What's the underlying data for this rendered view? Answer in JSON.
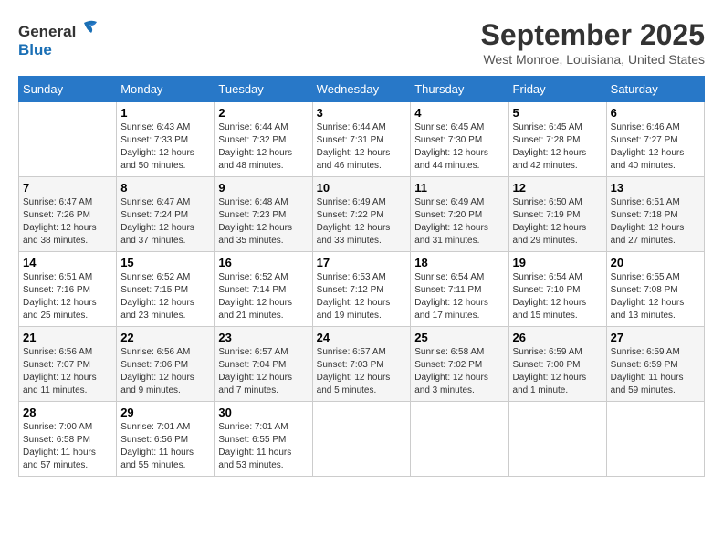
{
  "logo": {
    "line1": "General",
    "line2": "Blue"
  },
  "title": "September 2025",
  "location": "West Monroe, Louisiana, United States",
  "days_of_week": [
    "Sunday",
    "Monday",
    "Tuesday",
    "Wednesday",
    "Thursday",
    "Friday",
    "Saturday"
  ],
  "weeks": [
    [
      {
        "num": "",
        "info": ""
      },
      {
        "num": "1",
        "info": "Sunrise: 6:43 AM\nSunset: 7:33 PM\nDaylight: 12 hours\nand 50 minutes."
      },
      {
        "num": "2",
        "info": "Sunrise: 6:44 AM\nSunset: 7:32 PM\nDaylight: 12 hours\nand 48 minutes."
      },
      {
        "num": "3",
        "info": "Sunrise: 6:44 AM\nSunset: 7:31 PM\nDaylight: 12 hours\nand 46 minutes."
      },
      {
        "num": "4",
        "info": "Sunrise: 6:45 AM\nSunset: 7:30 PM\nDaylight: 12 hours\nand 44 minutes."
      },
      {
        "num": "5",
        "info": "Sunrise: 6:45 AM\nSunset: 7:28 PM\nDaylight: 12 hours\nand 42 minutes."
      },
      {
        "num": "6",
        "info": "Sunrise: 6:46 AM\nSunset: 7:27 PM\nDaylight: 12 hours\nand 40 minutes."
      }
    ],
    [
      {
        "num": "7",
        "info": "Sunrise: 6:47 AM\nSunset: 7:26 PM\nDaylight: 12 hours\nand 38 minutes."
      },
      {
        "num": "8",
        "info": "Sunrise: 6:47 AM\nSunset: 7:24 PM\nDaylight: 12 hours\nand 37 minutes."
      },
      {
        "num": "9",
        "info": "Sunrise: 6:48 AM\nSunset: 7:23 PM\nDaylight: 12 hours\nand 35 minutes."
      },
      {
        "num": "10",
        "info": "Sunrise: 6:49 AM\nSunset: 7:22 PM\nDaylight: 12 hours\nand 33 minutes."
      },
      {
        "num": "11",
        "info": "Sunrise: 6:49 AM\nSunset: 7:20 PM\nDaylight: 12 hours\nand 31 minutes."
      },
      {
        "num": "12",
        "info": "Sunrise: 6:50 AM\nSunset: 7:19 PM\nDaylight: 12 hours\nand 29 minutes."
      },
      {
        "num": "13",
        "info": "Sunrise: 6:51 AM\nSunset: 7:18 PM\nDaylight: 12 hours\nand 27 minutes."
      }
    ],
    [
      {
        "num": "14",
        "info": "Sunrise: 6:51 AM\nSunset: 7:16 PM\nDaylight: 12 hours\nand 25 minutes."
      },
      {
        "num": "15",
        "info": "Sunrise: 6:52 AM\nSunset: 7:15 PM\nDaylight: 12 hours\nand 23 minutes."
      },
      {
        "num": "16",
        "info": "Sunrise: 6:52 AM\nSunset: 7:14 PM\nDaylight: 12 hours\nand 21 minutes."
      },
      {
        "num": "17",
        "info": "Sunrise: 6:53 AM\nSunset: 7:12 PM\nDaylight: 12 hours\nand 19 minutes."
      },
      {
        "num": "18",
        "info": "Sunrise: 6:54 AM\nSunset: 7:11 PM\nDaylight: 12 hours\nand 17 minutes."
      },
      {
        "num": "19",
        "info": "Sunrise: 6:54 AM\nSunset: 7:10 PM\nDaylight: 12 hours\nand 15 minutes."
      },
      {
        "num": "20",
        "info": "Sunrise: 6:55 AM\nSunset: 7:08 PM\nDaylight: 12 hours\nand 13 minutes."
      }
    ],
    [
      {
        "num": "21",
        "info": "Sunrise: 6:56 AM\nSunset: 7:07 PM\nDaylight: 12 hours\nand 11 minutes."
      },
      {
        "num": "22",
        "info": "Sunrise: 6:56 AM\nSunset: 7:06 PM\nDaylight: 12 hours\nand 9 minutes."
      },
      {
        "num": "23",
        "info": "Sunrise: 6:57 AM\nSunset: 7:04 PM\nDaylight: 12 hours\nand 7 minutes."
      },
      {
        "num": "24",
        "info": "Sunrise: 6:57 AM\nSunset: 7:03 PM\nDaylight: 12 hours\nand 5 minutes."
      },
      {
        "num": "25",
        "info": "Sunrise: 6:58 AM\nSunset: 7:02 PM\nDaylight: 12 hours\nand 3 minutes."
      },
      {
        "num": "26",
        "info": "Sunrise: 6:59 AM\nSunset: 7:00 PM\nDaylight: 12 hours\nand 1 minute."
      },
      {
        "num": "27",
        "info": "Sunrise: 6:59 AM\nSunset: 6:59 PM\nDaylight: 11 hours\nand 59 minutes."
      }
    ],
    [
      {
        "num": "28",
        "info": "Sunrise: 7:00 AM\nSunset: 6:58 PM\nDaylight: 11 hours\nand 57 minutes."
      },
      {
        "num": "29",
        "info": "Sunrise: 7:01 AM\nSunset: 6:56 PM\nDaylight: 11 hours\nand 55 minutes."
      },
      {
        "num": "30",
        "info": "Sunrise: 7:01 AM\nSunset: 6:55 PM\nDaylight: 11 hours\nand 53 minutes."
      },
      {
        "num": "",
        "info": ""
      },
      {
        "num": "",
        "info": ""
      },
      {
        "num": "",
        "info": ""
      },
      {
        "num": "",
        "info": ""
      }
    ]
  ]
}
